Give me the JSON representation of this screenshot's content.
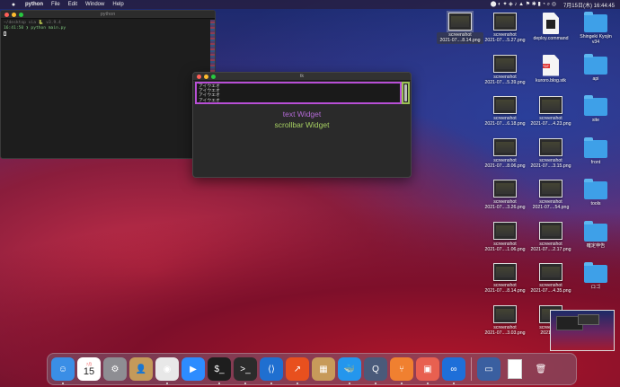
{
  "menubar": {
    "app_name": "python",
    "menus": [
      "File",
      "Edit",
      "Window",
      "Help"
    ],
    "clock": "7月15日(木)  16:44:45"
  },
  "terminal": {
    "title": "python",
    "lines": [
      {
        "text": "~/desktop via 🐍 v3.9.4",
        "style": "dim"
      },
      {
        "text": "16:41:50 ❯ python main.py",
        "style": "grn"
      }
    ]
  },
  "tk_window": {
    "title": "tk",
    "text_lines": [
      "アイウエオ",
      "アイウエオ",
      "アイウエオ",
      "アイウエオ"
    ],
    "text_label": "text Widget",
    "scroll_label": "scrollbar Widget"
  },
  "desktop": {
    "selected_caption": "screenshot\n2021-07....8.14.png",
    "col1": [
      {
        "kind": "screenshot",
        "caption": "screenshot\n2021-07....5.27.png"
      },
      {
        "kind": "screenshot",
        "caption": "screenshot\n2021-07....5.39.png"
      },
      {
        "kind": "screenshot",
        "caption": "screenshot\n2021-07....6.18.png"
      },
      {
        "kind": "screenshot",
        "caption": "screenshot\n2021-07....8.06.png"
      },
      {
        "kind": "screenshot",
        "caption": "screenshot\n2021-07....3.26.png"
      },
      {
        "kind": "screenshot",
        "caption": "screenshot\n2021-07....1.06.png"
      },
      {
        "kind": "screenshot",
        "caption": "screenshot\n2021-07....8.14.png"
      },
      {
        "kind": "screenshot",
        "caption": "screenshot\n2021-07....3.03.png"
      }
    ],
    "col2": [
      {
        "kind": "doc-black",
        "caption": "deploy.command"
      },
      {
        "kind": "doc-pdf",
        "caption": "kuroro.blog.stk"
      },
      {
        "kind": "screenshot",
        "caption": "screenshot\n2021-07....4.23.png"
      },
      {
        "kind": "screenshot",
        "caption": "screenshot\n2021-07....3.15.png"
      },
      {
        "kind": "screenshot",
        "caption": "screenshot\n2021-07....54.png"
      },
      {
        "kind": "screenshot",
        "caption": "screenshot\n2021-07....2.17.png"
      },
      {
        "kind": "screenshot",
        "caption": "screenshot\n2021-07....4.35.png"
      },
      {
        "kind": "screenshot",
        "caption": "screenshot\n2021-07..."
      }
    ],
    "col3": [
      {
        "kind": "folder",
        "caption": "Shingeki Kyojin\nv34"
      },
      {
        "kind": "folder",
        "caption": "api"
      },
      {
        "kind": "folder",
        "caption": "site"
      },
      {
        "kind": "folder",
        "caption": "front"
      },
      {
        "kind": "folder",
        "caption": "tools"
      },
      {
        "kind": "folder",
        "caption": "確定申告"
      },
      {
        "kind": "folder",
        "caption": "ロゴ"
      }
    ]
  },
  "dock": {
    "calendar_month": "7月",
    "calendar_day": "15",
    "apps": [
      {
        "name": "finder-icon",
        "glyph": "☺",
        "bg": "#3a8ee6"
      },
      {
        "name": "calendar-icon",
        "glyph": "",
        "bg": "#ffffff"
      },
      {
        "name": "system-preferences-icon",
        "glyph": "⚙",
        "bg": "#8e8e93"
      },
      {
        "name": "contacts-icon",
        "glyph": "👤",
        "bg": "#c49a5a"
      },
      {
        "name": "chrome-icon",
        "glyph": "◉",
        "bg": "#e8e8e8"
      },
      {
        "name": "zoom-icon",
        "glyph": "▶",
        "bg": "#2d8cff"
      },
      {
        "name": "iterm-icon",
        "glyph": "$_",
        "bg": "#1e1e1e"
      },
      {
        "name": "terminal-icon",
        "glyph": ">_",
        "bg": "#2b2b2b"
      },
      {
        "name": "vscode-icon",
        "glyph": "⟨⟩",
        "bg": "#1f6fd0"
      },
      {
        "name": "analytics-icon",
        "glyph": "↗",
        "bg": "#e8501e"
      },
      {
        "name": "archive-icon",
        "glyph": "▦",
        "bg": "#c79a5a"
      },
      {
        "name": "docker-icon",
        "glyph": "🐳",
        "bg": "#2496ed"
      },
      {
        "name": "quicktime-icon",
        "glyph": "Q",
        "bg": "#4a5a7a"
      },
      {
        "name": "sourcetree-icon",
        "glyph": "⑂",
        "bg": "#f08030"
      },
      {
        "name": "preview-icon",
        "glyph": "▣",
        "bg": "#e86050"
      },
      {
        "name": "infinity-icon",
        "glyph": "∞",
        "bg": "#1e6fd9"
      },
      {
        "name": "screenshot-app-icon",
        "glyph": "▭",
        "bg": "#3a5fa0"
      },
      {
        "name": "document-icon",
        "glyph": "",
        "bg": "#f2f2f2"
      },
      {
        "name": "trash-icon",
        "glyph": "🗑",
        "bg": "transparent"
      }
    ]
  }
}
